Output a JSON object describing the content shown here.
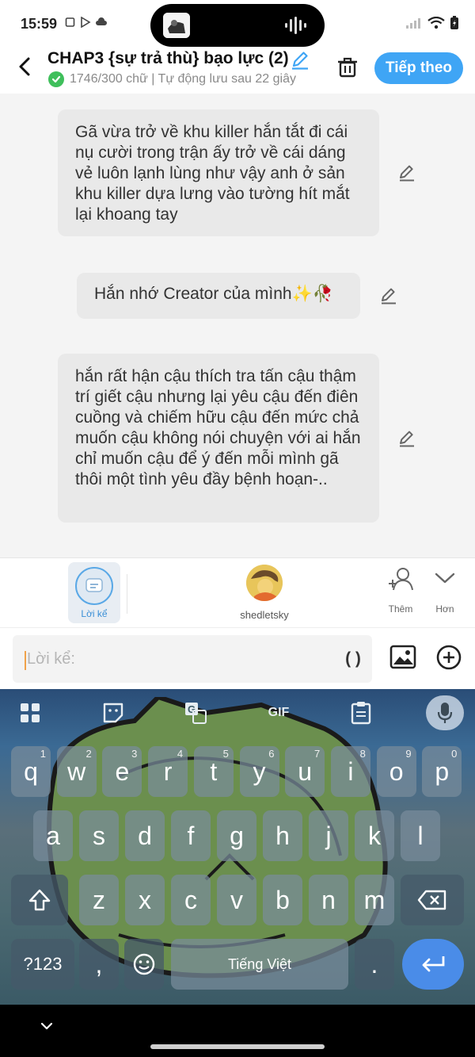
{
  "status_bar": {
    "time": "15:59"
  },
  "header": {
    "title": "CHAP3 {sự trả thù} bạo lực (2)",
    "status": "1746/300 chữ | Tự động lưu sau 22 giây",
    "next_label": "Tiếp theo",
    "accent_color": "#3fa5f5"
  },
  "messages": [
    {
      "text": "Gã vừa trở về khu killer hắn tắt đi cái nụ cười trong trận ấy trở về cái dáng vẻ luôn lạnh lùng như vậy anh ở sản khu killer dựa lưng vào tường hít mắt lại khoang tay"
    },
    {
      "text": "Hắn nhớ Creator của mình✨🥀"
    },
    {
      "text": "hắn rất hận cậu thích tra tấn cậu thậm trí giết cậu nhưng lại yêu cậu đến điên cuồng và chiếm hữu cậu đến mức chả muốn cậu không nói chuyện với ai hắn chỉ muốn cậu để ý đến mỗi mình gã thôi một tình yêu đầy bệnh hoạn-.."
    }
  ],
  "authors_bar": {
    "narrator_label": "Lời kể",
    "character_name": "shedletsky",
    "add_label": "Thêm",
    "more_label": "Hơn"
  },
  "composer": {
    "placeholder": "Lời kể:",
    "paren_label": "( )"
  },
  "keyboard": {
    "row1": [
      {
        "k": "q",
        "n": "1"
      },
      {
        "k": "w",
        "n": "2"
      },
      {
        "k": "e",
        "n": "3"
      },
      {
        "k": "r",
        "n": "4"
      },
      {
        "k": "t",
        "n": "5"
      },
      {
        "k": "y",
        "n": "6"
      },
      {
        "k": "u",
        "n": "7"
      },
      {
        "k": "i",
        "n": "8"
      },
      {
        "k": "o",
        "n": "9"
      },
      {
        "k": "p",
        "n": "0"
      }
    ],
    "row2": [
      "a",
      "s",
      "d",
      "f",
      "g",
      "h",
      "j",
      "k",
      "l"
    ],
    "row3": [
      "z",
      "x",
      "c",
      "v",
      "b",
      "n",
      "m"
    ],
    "symbols_label": "?123",
    "comma": ",",
    "period": ".",
    "space_label": "Tiếng Việt",
    "gif_label": "GIF"
  }
}
